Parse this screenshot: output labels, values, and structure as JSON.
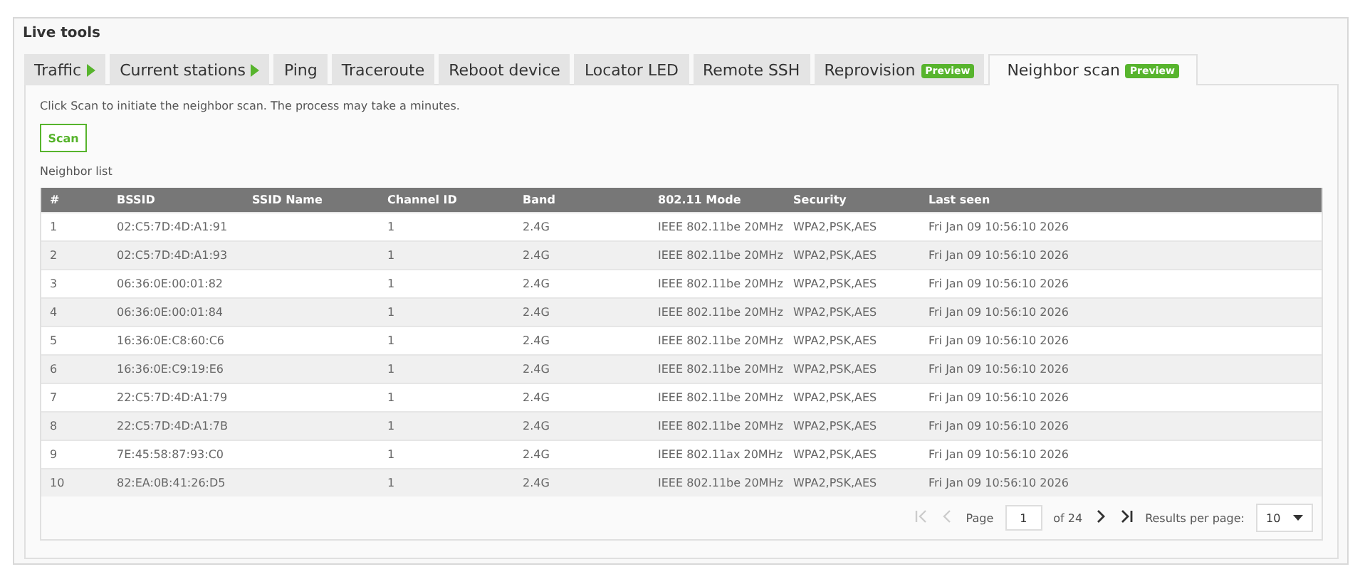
{
  "panel": {
    "title": "Live tools"
  },
  "tabs": [
    {
      "label": "Traffic",
      "selected": false,
      "arrow": true
    },
    {
      "label": "Current stations",
      "selected": false,
      "arrow": true
    },
    {
      "label": "Ping",
      "selected": false,
      "arrow": false
    },
    {
      "label": "Traceroute",
      "selected": false,
      "arrow": false
    },
    {
      "label": "Reboot device",
      "selected": false,
      "arrow": false
    },
    {
      "label": "Locator LED",
      "selected": false,
      "arrow": false
    },
    {
      "label": "Remote SSH",
      "selected": false,
      "arrow": false
    },
    {
      "label": "Reprovision",
      "selected": false,
      "arrow": false,
      "badge": "Preview"
    },
    {
      "label": "Neighbor scan",
      "selected": true,
      "arrow": false,
      "badge": "Preview"
    }
  ],
  "intro": "Click Scan to initiate the neighbor scan. The process may take a minutes.",
  "scan_button": "Scan",
  "list_title": "Neighbor list",
  "table": {
    "columns": [
      "#",
      "BSSID",
      "SSID Name",
      "Channel ID",
      "Band",
      "802.11 Mode",
      "Security",
      "Last seen"
    ],
    "rows": [
      [
        "1",
        "02:C5:7D:4D:A1:91",
        "",
        "1",
        "2.4G",
        "IEEE 802.11be 20MHz",
        "WPA2,PSK,AES",
        "Fri Jan 09 10:56:10 2026"
      ],
      [
        "2",
        "02:C5:7D:4D:A1:93",
        "",
        "1",
        "2.4G",
        "IEEE 802.11be 20MHz",
        "WPA2,PSK,AES",
        "Fri Jan 09 10:56:10 2026"
      ],
      [
        "3",
        "06:36:0E:00:01:82",
        "",
        "1",
        "2.4G",
        "IEEE 802.11be 20MHz",
        "WPA2,PSK,AES",
        "Fri Jan 09 10:56:10 2026"
      ],
      [
        "4",
        "06:36:0E:00:01:84",
        "",
        "1",
        "2.4G",
        "IEEE 802.11be 20MHz",
        "WPA2,PSK,AES",
        "Fri Jan 09 10:56:10 2026"
      ],
      [
        "5",
        "16:36:0E:C8:60:C6",
        "",
        "1",
        "2.4G",
        "IEEE 802.11be 20MHz",
        "WPA2,PSK,AES",
        "Fri Jan 09 10:56:10 2026"
      ],
      [
        "6",
        "16:36:0E:C9:19:E6",
        "",
        "1",
        "2.4G",
        "IEEE 802.11be 20MHz",
        "WPA2,PSK,AES",
        "Fri Jan 09 10:56:10 2026"
      ],
      [
        "7",
        "22:C5:7D:4D:A1:79",
        "",
        "1",
        "2.4G",
        "IEEE 802.11be 20MHz",
        "WPA2,PSK,AES",
        "Fri Jan 09 10:56:10 2026"
      ],
      [
        "8",
        "22:C5:7D:4D:A1:7B",
        "",
        "1",
        "2.4G",
        "IEEE 802.11be 20MHz",
        "WPA2,PSK,AES",
        "Fri Jan 09 10:56:10 2026"
      ],
      [
        "9",
        "7E:45:58:87:93:C0",
        "",
        "1",
        "2.4G",
        "IEEE 802.11ax 20MHz",
        "WPA2,PSK,AES",
        "Fri Jan 09 10:56:10 2026"
      ],
      [
        "10",
        "82:EA:0B:41:26:D5",
        "",
        "1",
        "2.4G",
        "IEEE 802.11be 20MHz",
        "WPA2,PSK,AES",
        "Fri Jan 09 10:56:10 2026"
      ]
    ]
  },
  "pager": {
    "first_disabled": true,
    "prev_disabled": true,
    "next_disabled": false,
    "last_disabled": false,
    "page_label": "Page",
    "page": "1",
    "of": "of 24",
    "per_page_label": "Results per page:",
    "per_page": "10"
  }
}
